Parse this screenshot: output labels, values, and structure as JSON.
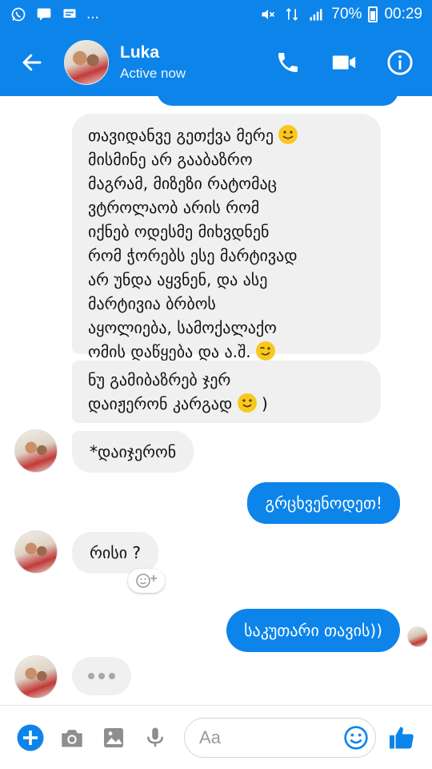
{
  "status_bar": {
    "battery": "70%",
    "time": "00:29",
    "dots": "..."
  },
  "header": {
    "contact_name": "Luka",
    "contact_status": "Active now"
  },
  "messages": {
    "m1": {
      "lines": [
        "თავიდანვე გეთქვა მერე",
        "მისმინე არ გააბაზრო",
        "მაგრამ, მიზეზი რატომაც",
        "ვტროლაობ არის რომ",
        "იქნებ ოდესმე მიხვდნენ",
        "რომ ჭორებს ესე მარტივად",
        "არ უნდა აყვნენ, და ასე",
        "მარტივია ბრბოს",
        "აყოლიება, სამოქალაქო",
        "ომის დაწყება და ა.შ."
      ]
    },
    "m2": {
      "lines": [
        "ნუ გამიბაზრებ ჯერ",
        "დაიჟერონ კარგად"
      ],
      "tail": ")"
    },
    "m3": {
      "text": "*დაიჯერონ"
    },
    "m4": {
      "text": "გრცხვენოდეთ!"
    },
    "m5": {
      "text": "რისი ?"
    },
    "m6": {
      "text": "საკუთარი თავის))"
    }
  },
  "composer": {
    "placeholder": "Aa"
  },
  "icons": {
    "back": "arrow-back-icon",
    "call": "phone-icon",
    "video": "video-camera-icon",
    "info": "info-icon",
    "add": "plus-circle-icon",
    "camera": "camera-icon",
    "gallery": "image-icon",
    "mic": "microphone-icon",
    "emoji": "smiley-icon",
    "like": "thumbs-up-icon"
  },
  "colors": {
    "brand": "#0d84ea",
    "incoming_bubble": "#f1f0f0",
    "outgoing_bubble": "#0d84ea"
  }
}
